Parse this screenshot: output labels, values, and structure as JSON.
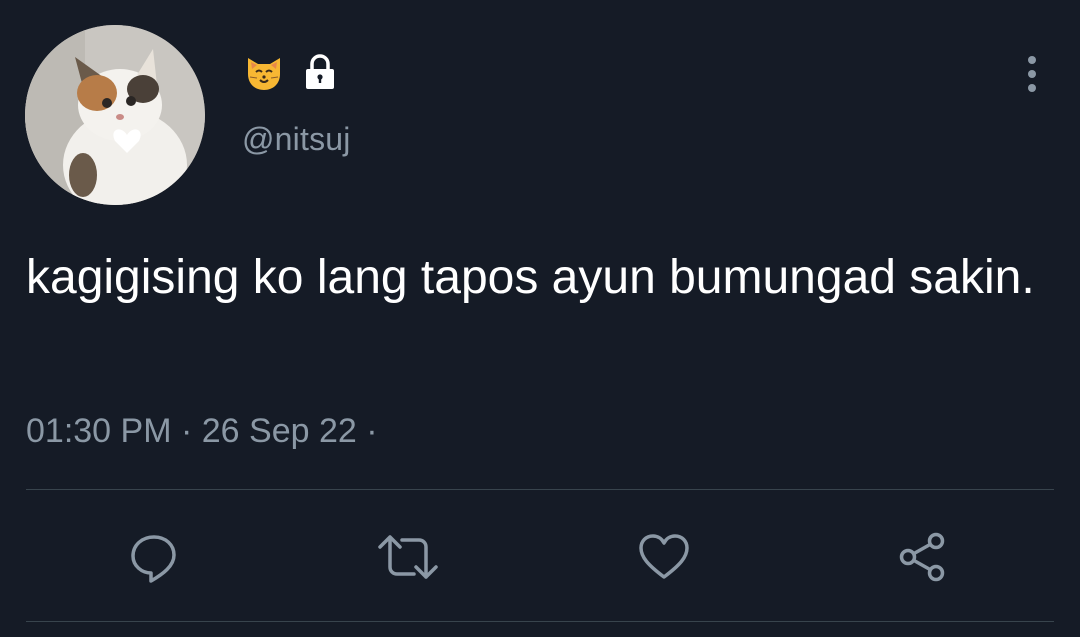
{
  "tweet": {
    "handle": "@nitsuj",
    "name_emoji": "🐱",
    "protected_icon": "lock-icon",
    "text": "kagigising ko lang tapos ayun bumungad sakin.",
    "time": "01:30 PM",
    "separator1": "·",
    "date": "26 Sep 22",
    "separator2": "·"
  },
  "actions": [
    {
      "icon": "reply-icon"
    },
    {
      "icon": "retweet-icon"
    },
    {
      "icon": "like-icon"
    },
    {
      "icon": "share-icon"
    }
  ],
  "colors": {
    "background": "#151b26",
    "text": "#ffffff",
    "secondary": "#8b98a5",
    "divider": "#38444d"
  }
}
